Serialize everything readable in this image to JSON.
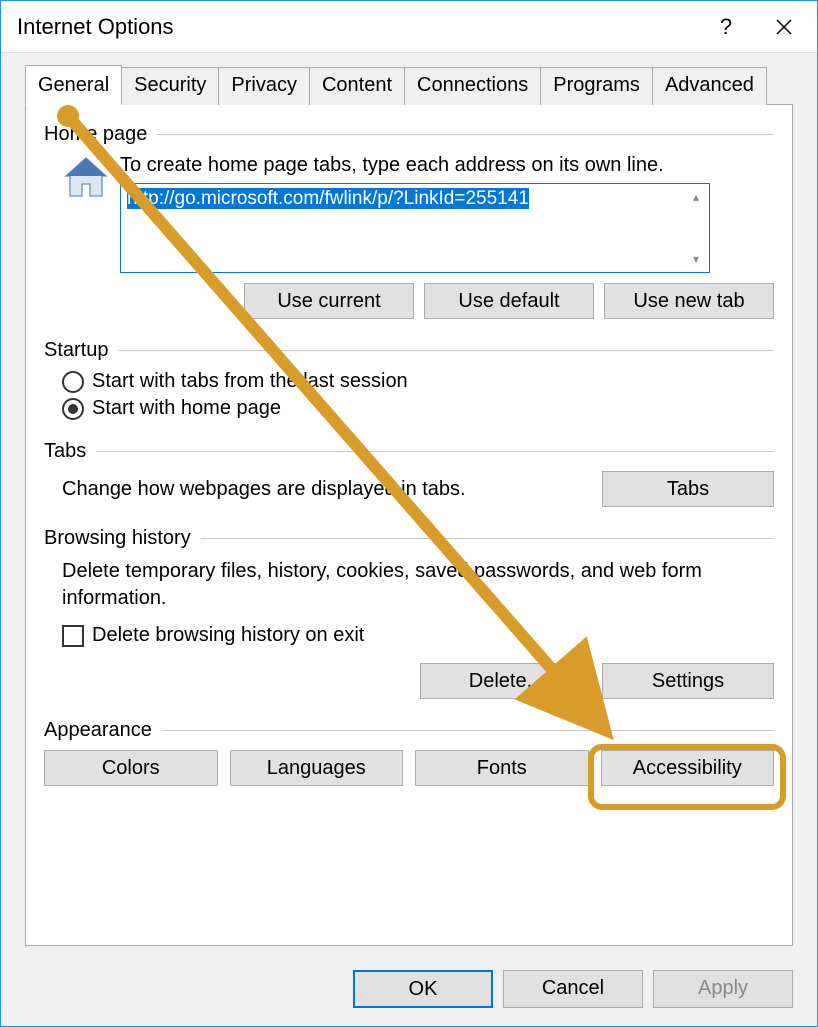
{
  "window": {
    "title": "Internet Options"
  },
  "tabs": [
    "General",
    "Security",
    "Privacy",
    "Content",
    "Connections",
    "Programs",
    "Advanced"
  ],
  "active_tab": "General",
  "homepage": {
    "legend": "Home page",
    "instruction": "To create home page tabs, type each address on its own line.",
    "value": "http://go.microsoft.com/fwlink/p/?LinkId=255141",
    "buttons": {
      "use_current": "Use current",
      "use_default": "Use default",
      "use_new_tab": "Use new tab"
    }
  },
  "startup": {
    "legend": "Startup",
    "options": {
      "last_session": "Start with tabs from the last session",
      "home_page": "Start with home page"
    },
    "selected": "home_page"
  },
  "tabs_group": {
    "legend": "Tabs",
    "text": "Change how webpages are displayed in tabs.",
    "button": "Tabs"
  },
  "history": {
    "legend": "Browsing history",
    "text": "Delete temporary files, history, cookies, saved passwords, and web form information.",
    "checkbox": "Delete browsing history on exit",
    "checkbox_checked": false,
    "buttons": {
      "delete": "Delete...",
      "settings": "Settings"
    }
  },
  "appearance": {
    "legend": "Appearance",
    "buttons": {
      "colors": "Colors",
      "languages": "Languages",
      "fonts": "Fonts",
      "accessibility": "Accessibility"
    }
  },
  "bottom": {
    "ok": "OK",
    "cancel": "Cancel",
    "apply": "Apply"
  },
  "annotation": {
    "highlight_target": "settings-button",
    "arrow_from": "general-tab",
    "color": "#d99c2b"
  }
}
